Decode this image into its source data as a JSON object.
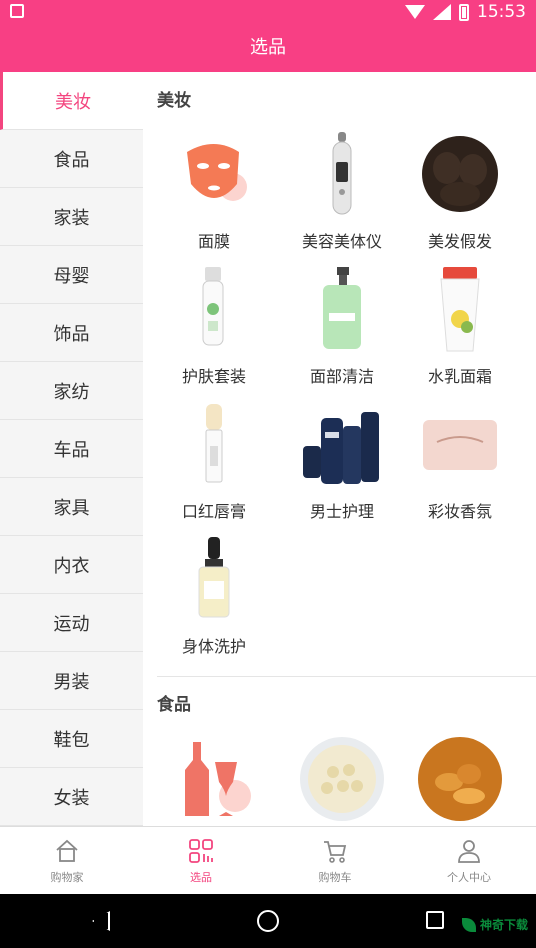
{
  "statusbar": {
    "time": "15:53"
  },
  "titlebar": {
    "title": "选品"
  },
  "sidebar": {
    "items": [
      {
        "label": "美妆"
      },
      {
        "label": "食品"
      },
      {
        "label": "家装"
      },
      {
        "label": "母婴"
      },
      {
        "label": "饰品"
      },
      {
        "label": "家纺"
      },
      {
        "label": "车品"
      },
      {
        "label": "家具"
      },
      {
        "label": "内衣"
      },
      {
        "label": "运动"
      },
      {
        "label": "男装"
      },
      {
        "label": "鞋包"
      },
      {
        "label": "女装"
      }
    ]
  },
  "content": {
    "sections": [
      {
        "title": "美妆",
        "items": [
          {
            "label": "面膜"
          },
          {
            "label": "美容美体仪"
          },
          {
            "label": "美发假发"
          },
          {
            "label": "护肤套装"
          },
          {
            "label": "面部清洁"
          },
          {
            "label": "水乳面霜"
          },
          {
            "label": "口红唇膏"
          },
          {
            "label": "男士护理"
          },
          {
            "label": "彩妆香氛"
          },
          {
            "label": "身体洗护"
          }
        ]
      },
      {
        "title": "食品"
      }
    ]
  },
  "bottom_tabs": [
    {
      "label": "购物家",
      "icon": "home-icon"
    },
    {
      "label": "选品",
      "icon": "grid-icon"
    },
    {
      "label": "购物车",
      "icon": "cart-icon"
    },
    {
      "label": "个人中心",
      "icon": "person-icon"
    }
  ],
  "watermark": {
    "text": "神奇下载"
  },
  "colors": {
    "accent": "#f83f84",
    "active_text": "#f3457f"
  }
}
